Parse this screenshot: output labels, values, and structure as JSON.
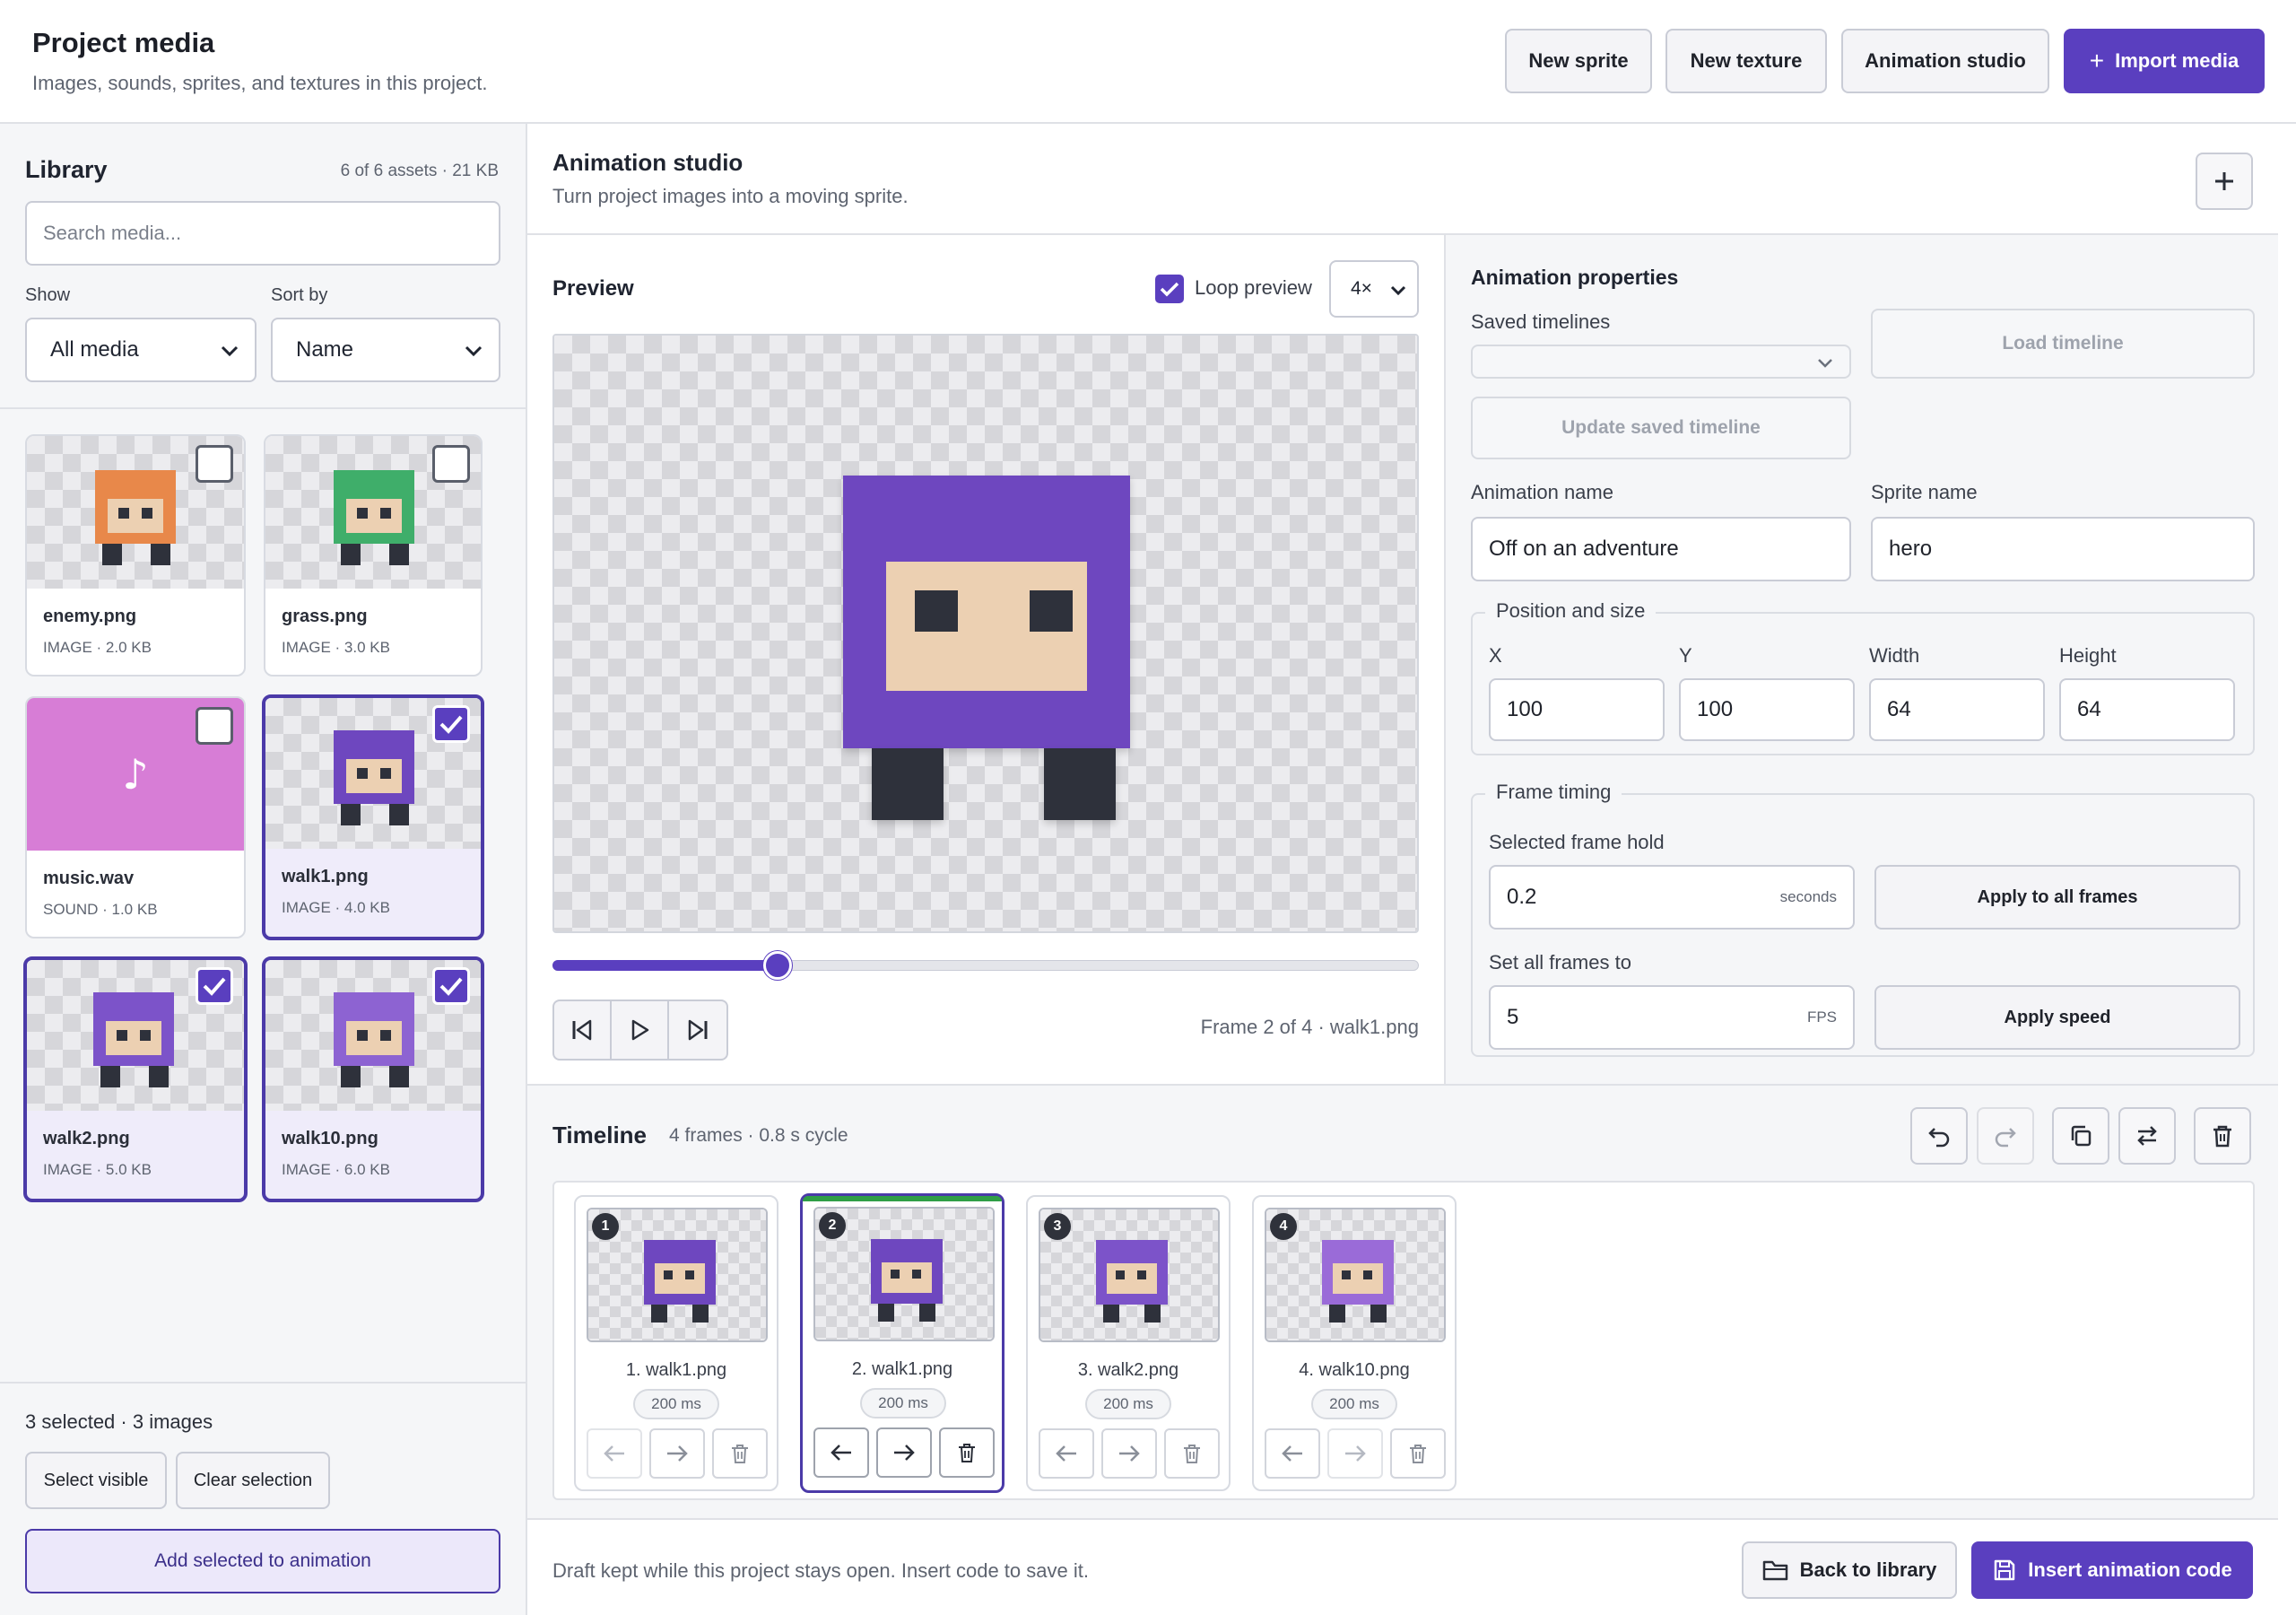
{
  "header": {
    "title": "Project media",
    "subtitle": "Images, sounds, sprites, and textures in this project.",
    "buttons": {
      "new_sprite": "New sprite",
      "new_texture": "New texture",
      "animation_studio": "Animation studio",
      "import_media": "Import media"
    }
  },
  "library": {
    "title": "Library",
    "count": "6 of 6 assets · 21 KB",
    "search_placeholder": "Search media...",
    "show_label": "Show",
    "show_value": "All media",
    "sort_label": "Sort by",
    "sort_value": "Name",
    "assets": [
      {
        "name": "enemy.png",
        "meta": "IMAGE · 2.0 KB",
        "selected": false,
        "color": "#e8884a"
      },
      {
        "name": "grass.png",
        "meta": "IMAGE · 3.0 KB",
        "selected": false,
        "color": "#3fae6a"
      },
      {
        "name": "music.wav",
        "meta": "SOUND · 1.0 KB",
        "selected": false,
        "color": "#d77dd6"
      },
      {
        "name": "walk1.png",
        "meta": "IMAGE · 4.0 KB",
        "selected": true,
        "color": "#6e47bf"
      },
      {
        "name": "walk2.png",
        "meta": "IMAGE · 5.0 KB",
        "selected": true,
        "color": "#7c53c9"
      },
      {
        "name": "walk10.png",
        "meta": "IMAGE · 6.0 KB",
        "selected": true,
        "color": "#8d63d2"
      }
    ],
    "selection_summary": "3 selected · 3 images",
    "select_visible": "Select visible",
    "clear_selection": "Clear selection",
    "add_selected": "Add selected to animation"
  },
  "studio": {
    "title": "Animation studio",
    "subtitle": "Turn project images into a moving sprite.",
    "preview": {
      "title": "Preview",
      "loop_label": "Loop preview",
      "loop_checked": true,
      "zoom": "4×",
      "scrub_progress": 0.26,
      "frame_info": "Frame 2 of 4 · walk1.png",
      "sprite_color": "#6e47bf"
    },
    "properties": {
      "title": "Animation properties",
      "saved_timelines_label": "Saved timelines",
      "saved_timelines_value": "",
      "load_timeline": "Load timeline",
      "update_saved_timeline": "Update saved timeline",
      "animation_name_label": "Animation name",
      "animation_name_value": "Off on an adventure",
      "sprite_name_label": "Sprite name",
      "sprite_name_value": "hero",
      "position_legend": "Position and size",
      "x_label": "X",
      "x_value": "100",
      "y_label": "Y",
      "y_value": "100",
      "width_label": "Width",
      "width_value": "64",
      "height_label": "Height",
      "height_value": "64",
      "timing_legend": "Frame timing",
      "hold_label": "Selected frame hold",
      "hold_value": "0.2",
      "hold_unit": "seconds",
      "apply_all_frames": "Apply to all frames",
      "set_all_label": "Set all frames to",
      "fps_value": "5",
      "fps_unit": "FPS",
      "apply_speed": "Apply speed"
    },
    "timeline": {
      "title": "Timeline",
      "summary": "4 frames · 0.8 s cycle",
      "frames": [
        {
          "num": "1",
          "name": "1. walk1.png",
          "ms": "200 ms",
          "active": false,
          "color": "#6e47bf"
        },
        {
          "num": "2",
          "name": "2. walk1.png",
          "ms": "200 ms",
          "active": true,
          "color": "#6e47bf"
        },
        {
          "num": "3",
          "name": "3. walk2.png",
          "ms": "200 ms",
          "active": false,
          "color": "#7c53c9"
        },
        {
          "num": "4",
          "name": "4. walk10.png",
          "ms": "200 ms",
          "active": false,
          "color": "#9a6bd8"
        }
      ]
    },
    "footer": {
      "note": "Draft kept while this project stays open. Insert code to save it.",
      "back": "Back to library",
      "insert": "Insert animation code"
    }
  },
  "colors": {
    "accent": "#5a3fbf",
    "selected_border": "#4b3aa8",
    "panel_bg": "#f5f6f8"
  }
}
